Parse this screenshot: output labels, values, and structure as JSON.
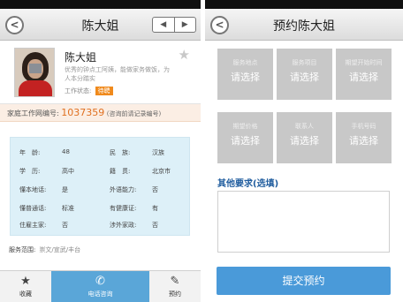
{
  "left": {
    "title": "陈大姐",
    "pager": {
      "prev": "◀",
      "next": "▶"
    },
    "profile": {
      "name": "陈大姐",
      "desc": "优秀的钟点工阿姨，能做家务做饭，为人本分踏实",
      "status_label": "工作状态:",
      "status_value": "待聘"
    },
    "code": {
      "label": "家庭工作网编号:",
      "number": "1037359",
      "hint": "(咨询前请记录编号)"
    },
    "info": [
      {
        "k1": "年　龄:",
        "v1": "48",
        "k2": "民　族:",
        "v2": "汉族"
      },
      {
        "k1": "学　历:",
        "v1": "高中",
        "k2": "籍　贯:",
        "v2": "北京市"
      },
      {
        "k1": "懂本地话:",
        "v1": "是",
        "k2": "外语能力:",
        "v2": "否"
      },
      {
        "k1": "懂普通话:",
        "v1": "标准",
        "k2": "有健康证:",
        "v2": "有"
      },
      {
        "k1": "住雇主家:",
        "v1": "否",
        "k2": "涉外家政:",
        "v2": "否"
      }
    ],
    "range": {
      "label": "服务范围:",
      "value": "崇文/宣武/丰台"
    },
    "tabs": {
      "collect": "收藏",
      "call": "电话咨询",
      "book": "预约"
    }
  },
  "right": {
    "title": "预约陈大姐",
    "cells": [
      {
        "label": "服务地点",
        "value": "请选择"
      },
      {
        "label": "服务项目",
        "value": "请选择"
      },
      {
        "label": "期望开始时间",
        "value": "请选择"
      },
      {
        "label": "期望价格",
        "value": "请选择"
      },
      {
        "label": "联系人",
        "value": "请选择"
      },
      {
        "label": "手机号码",
        "value": "请选择"
      }
    ],
    "other_title": "其他要求(选填)",
    "submit": "提交预约"
  },
  "icons": {
    "back": "back-arrow-icon",
    "star": "star-icon",
    "phone": "phone-icon",
    "edit": "edit-icon"
  },
  "colors": {
    "accent": "#4a9ad9",
    "code_number": "#e07020",
    "badge": "#f08a1c",
    "info_bg": "#ddf0f8",
    "cell_bg": "#c8c8c8"
  }
}
